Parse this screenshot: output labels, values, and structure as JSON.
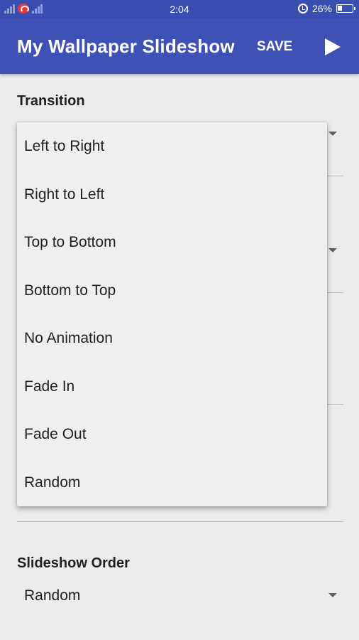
{
  "status_bar": {
    "time": "2:04",
    "battery": "26%"
  },
  "app_bar": {
    "title": "My Wallpaper Slideshow",
    "save_label": "SAVE",
    "play_icon": "play-icon"
  },
  "transition": {
    "label": "Transition",
    "options": [
      "Left to Right",
      "Right to Left",
      "Top to Bottom",
      "Bottom to Top",
      "No Animation",
      "Fade In",
      "Fade Out",
      "Random"
    ]
  },
  "slideshow_order": {
    "label": "Slideshow Order",
    "value": "Random"
  },
  "colors": {
    "app_bar": "#3f51b5",
    "status_bar": "#3a4db0",
    "background": "#ececec"
  }
}
